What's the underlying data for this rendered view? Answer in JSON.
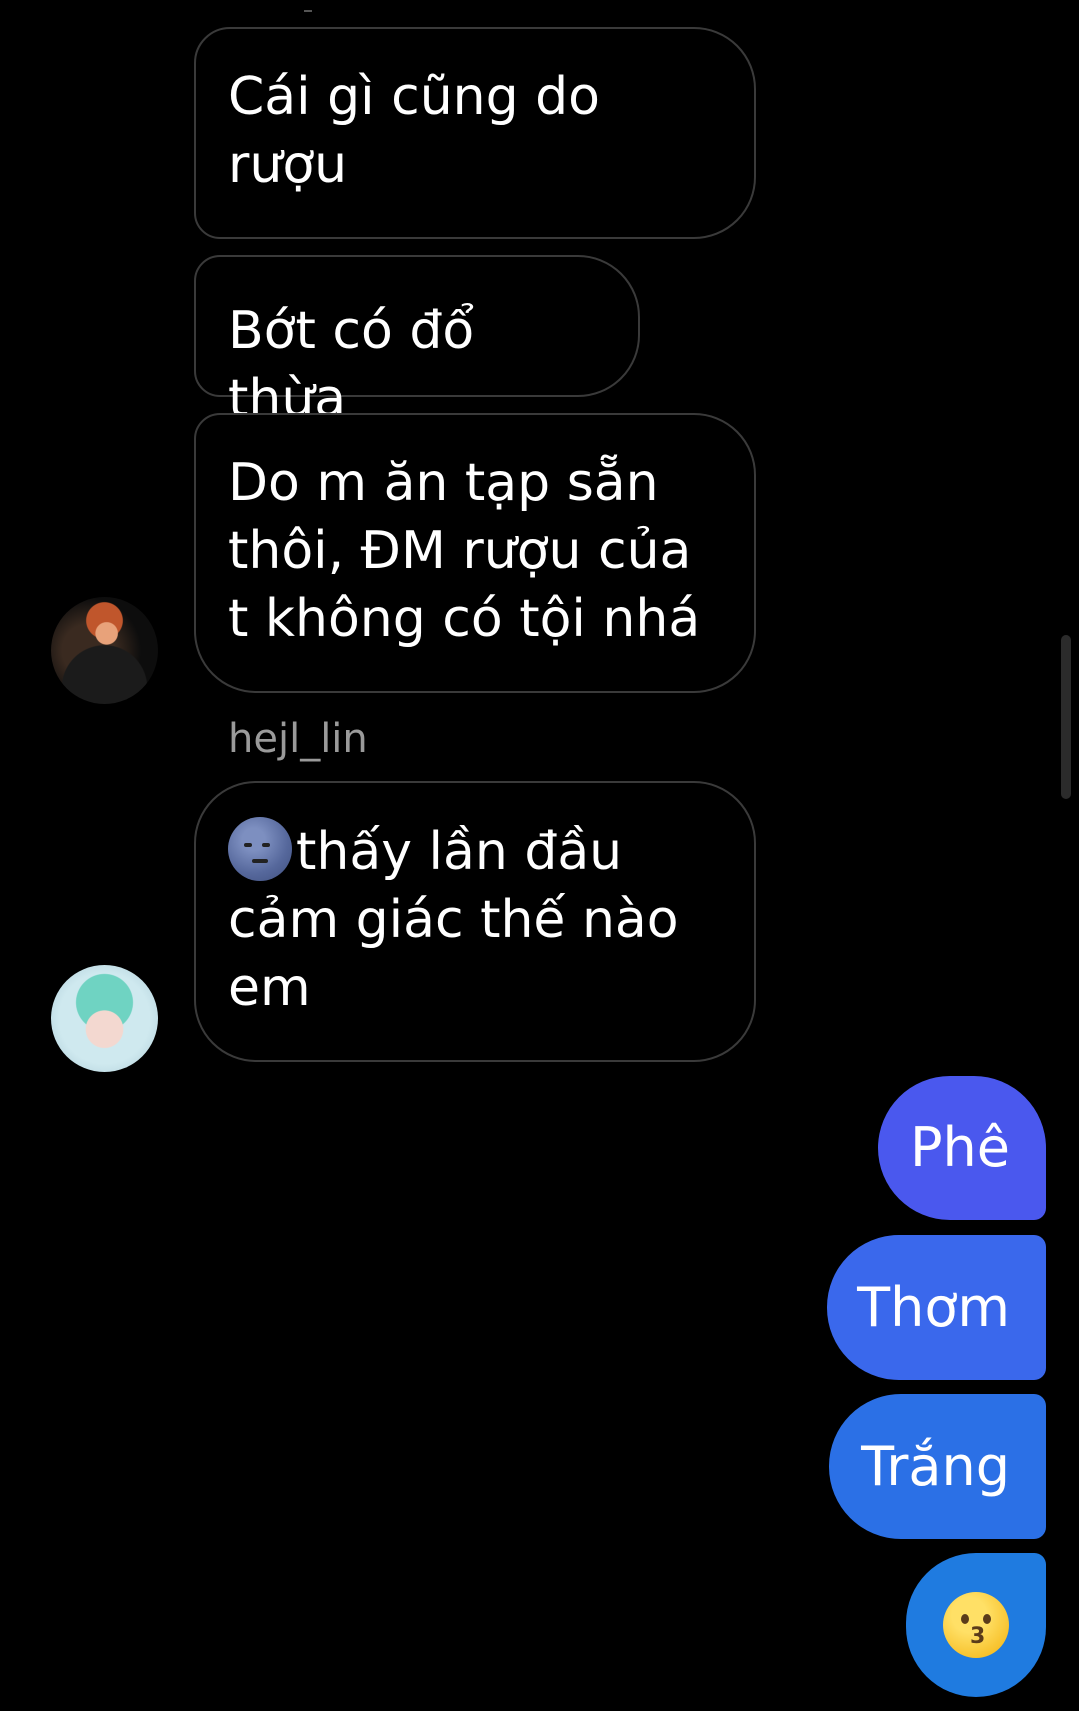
{
  "conversation": {
    "incoming": [
      {
        "text": "Cái gì cũng do rượu"
      },
      {
        "text": "Bớt có đổ thừa"
      },
      {
        "text": "Do m ăn tạp sẵn thôi, ĐM rượu của t không có tội nhá"
      },
      {
        "text": "thấy lần đầu cảm giác thế nào em",
        "emoji": "new-moon-face-emoji"
      }
    ],
    "username_label": "hejl_lin",
    "outgoing": [
      {
        "text": "Phê"
      },
      {
        "text": "Thơm"
      },
      {
        "text": "Trắng"
      },
      {
        "emoji": "kissing-face-emoji"
      }
    ]
  },
  "colors": {
    "background": "#000000",
    "incoming_border": "#3a3a3a",
    "outgoing_gradient": [
      "#4a58ee",
      "#1f7be0"
    ],
    "username": "#9a9a9a"
  }
}
